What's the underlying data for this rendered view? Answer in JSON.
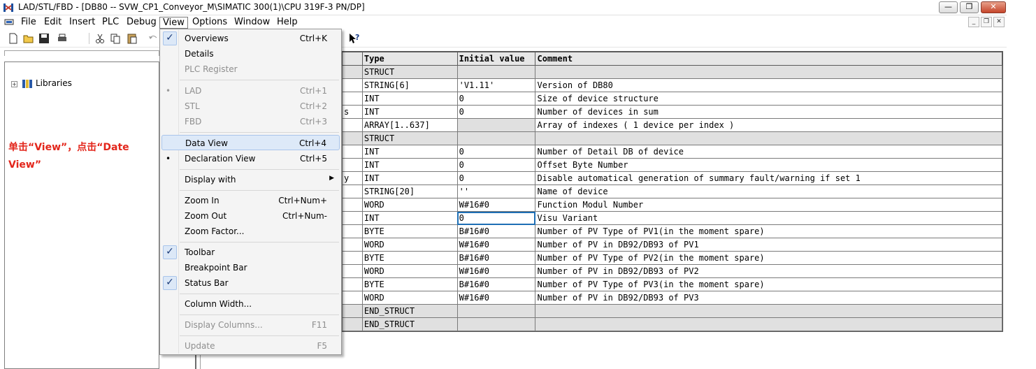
{
  "window": {
    "title": "LAD/STL/FBD  - [DB80 -- SVW_CP1_Conveyor_M\\SIMATIC 300(1)\\CPU 319F-3 PN/DP]",
    "buttons": [
      "minimize",
      "restore",
      "close"
    ]
  },
  "menubar": {
    "items": [
      "File",
      "Edit",
      "Insert",
      "PLC",
      "Debug",
      "View",
      "Options",
      "Window",
      "Help"
    ],
    "active": "View"
  },
  "tree": {
    "root_label": "Libraries"
  },
  "annotation": "单击“View”，点击“Date View”",
  "view_menu": {
    "items": [
      {
        "label": "Overviews",
        "shortcut": "Ctrl+K",
        "state": "checked"
      },
      {
        "label": "Details",
        "shortcut": "",
        "state": ""
      },
      {
        "label": "PLC Register",
        "shortcut": "",
        "state": "disabled"
      },
      {
        "label": "LAD",
        "shortcut": "Ctrl+1",
        "state": "disabled-bullet"
      },
      {
        "label": "STL",
        "shortcut": "Ctrl+2",
        "state": "disabled"
      },
      {
        "label": "FBD",
        "shortcut": "Ctrl+3",
        "state": "disabled"
      },
      {
        "label": "Data View",
        "shortcut": "Ctrl+4",
        "state": "hover"
      },
      {
        "label": "Declaration View",
        "shortcut": "Ctrl+5",
        "state": "bullet"
      },
      {
        "label": "Display with",
        "shortcut": "",
        "state": "submenu"
      },
      {
        "label": "Zoom In",
        "shortcut": "Ctrl+Num+",
        "state": ""
      },
      {
        "label": "Zoom Out",
        "shortcut": "Ctrl+Num-",
        "state": ""
      },
      {
        "label": "Zoom Factor...",
        "shortcut": "",
        "state": ""
      },
      {
        "label": "Toolbar",
        "shortcut": "",
        "state": "checked"
      },
      {
        "label": "Breakpoint Bar",
        "shortcut": "",
        "state": ""
      },
      {
        "label": "Status Bar",
        "shortcut": "",
        "state": "checked"
      },
      {
        "label": "Column Width...",
        "shortcut": "",
        "state": ""
      },
      {
        "label": "Display Columns...",
        "shortcut": "F11",
        "state": "disabled"
      },
      {
        "label": "Update",
        "shortcut": "F5",
        "state": "disabled"
      }
    ]
  },
  "grid": {
    "headers": [
      "",
      "Type",
      "Initial value",
      "Comment"
    ],
    "rows": [
      {
        "addr": "",
        "type": "STRUCT",
        "init": "",
        "comment": "",
        "struct": true
      },
      {
        "addr": "",
        "type": "STRING[6]",
        "init": "'V1.11'",
        "comment": " Version of DB80"
      },
      {
        "addr": "",
        "type": "INT",
        "init": "0",
        "comment": "Size of device structure"
      },
      {
        "addr": "s",
        "type": "INT",
        "init": "0",
        "comment": "Number of devices in sum"
      },
      {
        "addr": "",
        "type": "ARRAY[1..637]",
        "init": "",
        "comment": "Array of indexes ( 1 device per index )",
        "shade_init": true
      },
      {
        "addr": "",
        "type": "STRUCT",
        "init": "",
        "comment": "",
        "struct": true
      },
      {
        "addr": "",
        "type": "INT",
        "init": "0",
        "comment": "Number of Detail DB of device"
      },
      {
        "addr": "",
        "type": "INT",
        "init": "0",
        "comment": "Offset Byte Number"
      },
      {
        "addr": "y",
        "type": "INT",
        "init": "0",
        "comment": "Disable automatical generation of summary fault/warning if set 1"
      },
      {
        "addr": "",
        "type": "STRING[20]",
        "init": "''",
        "comment": "Name of device"
      },
      {
        "addr": "",
        "type": "WORD",
        "init": "W#16#0",
        "comment": "Function Modul Number"
      },
      {
        "addr": "",
        "type": "INT",
        "init": "0",
        "comment": "Visu Variant",
        "cursor": true
      },
      {
        "addr": "",
        "type": "BYTE",
        "init": "B#16#0",
        "comment": "Number of PV Type of PV1(in the moment spare)"
      },
      {
        "addr": "",
        "type": "WORD",
        "init": "W#16#0",
        "comment": "Number of PV in DB92/DB93 of PV1"
      },
      {
        "addr": "",
        "type": "BYTE",
        "init": "B#16#0",
        "comment": "Number of PV Type of PV2(in the moment spare)"
      },
      {
        "addr": "",
        "type": "WORD",
        "init": "W#16#0",
        "comment": "Number of PV in DB92/DB93 of PV2"
      },
      {
        "addr": "",
        "type": "BYTE",
        "init": "B#16#0",
        "comment": "Number of PV Type of PV3(in the moment spare)"
      },
      {
        "addr": "",
        "type": "WORD",
        "init": "W#16#0",
        "comment": "Number of PV in DB92/DB93 of PV3"
      },
      {
        "addr": "",
        "type": "END_STRUCT",
        "init": "",
        "comment": "",
        "struct": true
      },
      {
        "addr": "",
        "type": "END_STRUCT",
        "init": "",
        "comment": "",
        "struct": true
      }
    ]
  }
}
